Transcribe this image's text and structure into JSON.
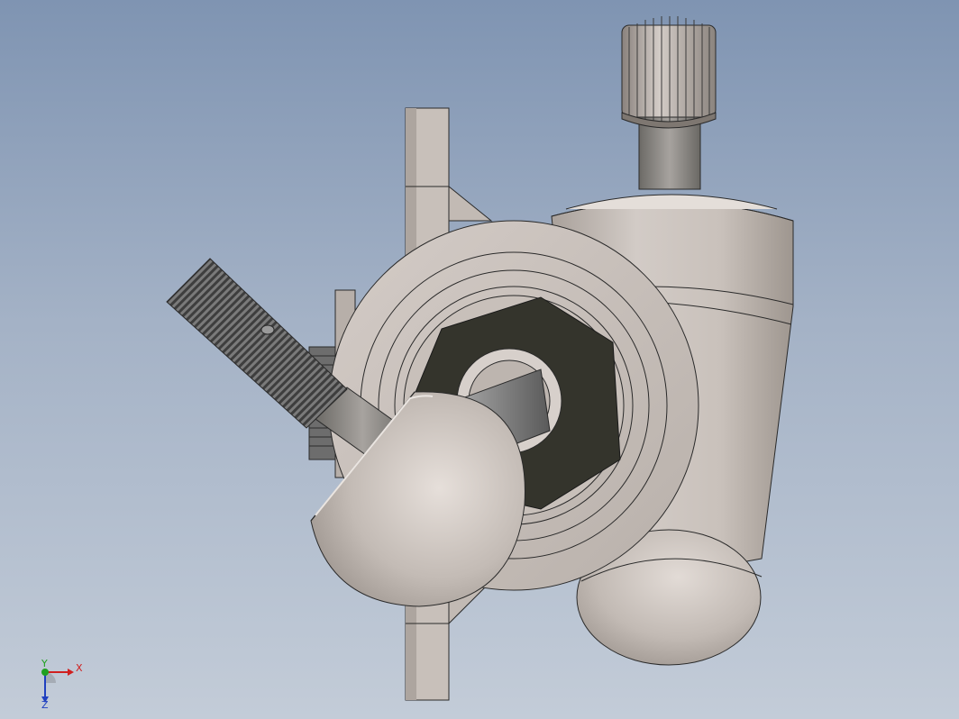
{
  "viewport": {
    "background_top": "#7f94b2",
    "background_bottom": "#c3ccd8"
  },
  "model": {
    "parts": [
      "bracket",
      "flange",
      "housing-body",
      "knurled-knob",
      "threaded-rod",
      "ball-joint",
      "lower-dome"
    ],
    "colors": {
      "part": "#cfc7c1",
      "part_shade": "#a9a19b",
      "edge": "#2a2a2a",
      "bore": "#34342c",
      "shaft": "#8a8a8a",
      "thread": "#5a5a5a"
    }
  },
  "triad": {
    "x_label": "X",
    "y_label": "Y",
    "z_label": "Z",
    "x_color": "#d02020",
    "y_color": "#20a020",
    "z_color": "#2040c0"
  }
}
